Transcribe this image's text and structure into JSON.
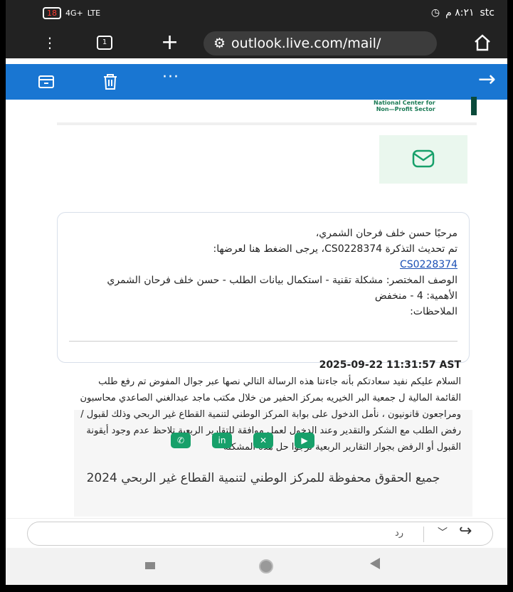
{
  "status_bar": {
    "battery": "18",
    "signal": "4G+",
    "lte": "LTE",
    "time": "٨:٢١ م",
    "carrier": "stc"
  },
  "browser": {
    "tabs_count": "1",
    "url": "outlook.live.com/mail/"
  },
  "toolbar": {
    "more_label": "···"
  },
  "email": {
    "logo_line1": "National Center for",
    "logo_line2": "Non—Profit Sector",
    "card_lines": [
      "مرحبًا حسن خلف فرحان الشمري،",
      "تم تحديث التذكرة CS0228374، يرجى الضغط هنا لعرضها:",
      "CS0228374",
      "الوصف المختصر: مشكلة تقنية - استكمال بيانات الطلب - حسن خلف فرحان الشمري",
      "الأهمية: 4 - منخفض",
      "الملاحظات:"
    ],
    "message_header": "2025-09-22 11:31:57 AST",
    "message_body": "السلام عليكم نفيد سعادتكم بأنه جاءتنا هذه الرسالة التالي نصها عبر جوال المفوض تم رفع طلب القائمة المالية ل جمعية البر الخيريه بمركز الحفير من خلال مكتب ماجد عبدالغني الصاعدي محاسبون ومراجعون قانونيون ، نأمل الدخول على بوابة المركز الوطني لتنمية القطاع غير الربحي وذلك لقبول / رفض الطلب مع الشكر والتقدير وعند الدخول لعمل موافقة للتقارير الربعية تلاحظ عدم وجود أيقونة القبول أو الرفض بجوار التقارير الربعية نرجوا حل هذه المشكلة",
    "copyright": "جميع الحقوق محفوظة للمركز الوطني لتنمية القطاع غير الربحي 2024"
  },
  "reply": {
    "label": "رد"
  },
  "colors": {
    "toolbar_blue": "#1976d2",
    "social_green": "#17a06a",
    "link_blue": "#1a4fb5"
  }
}
